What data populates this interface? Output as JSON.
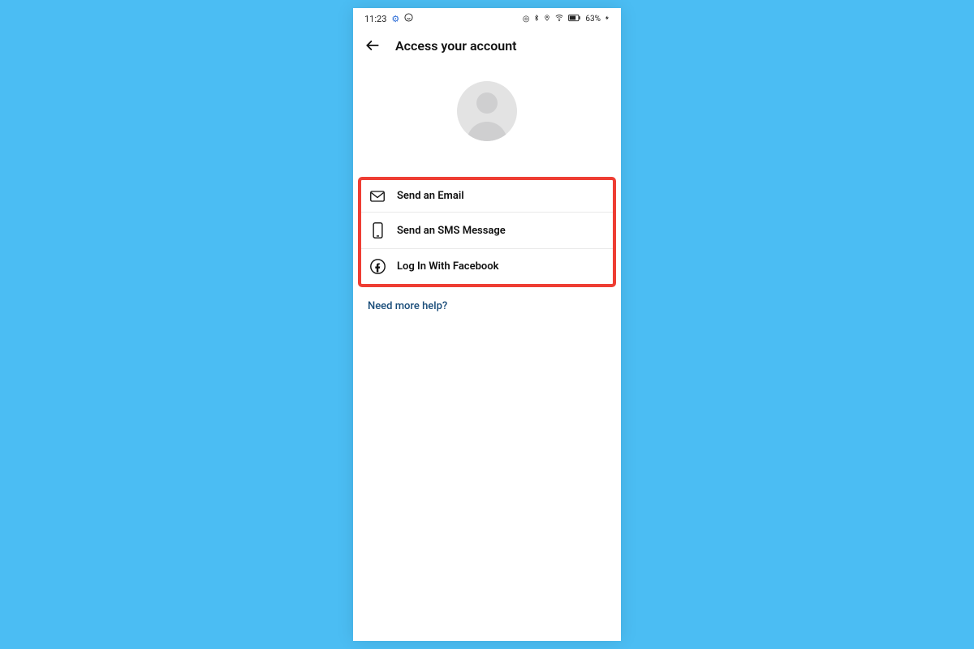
{
  "status_bar": {
    "time": "11:23",
    "battery_text": "63%"
  },
  "header": {
    "title": "Access your account"
  },
  "options": {
    "email": "Send an Email",
    "sms": "Send an SMS Message",
    "facebook": "Log In With Facebook"
  },
  "help_link": "Need more help?"
}
